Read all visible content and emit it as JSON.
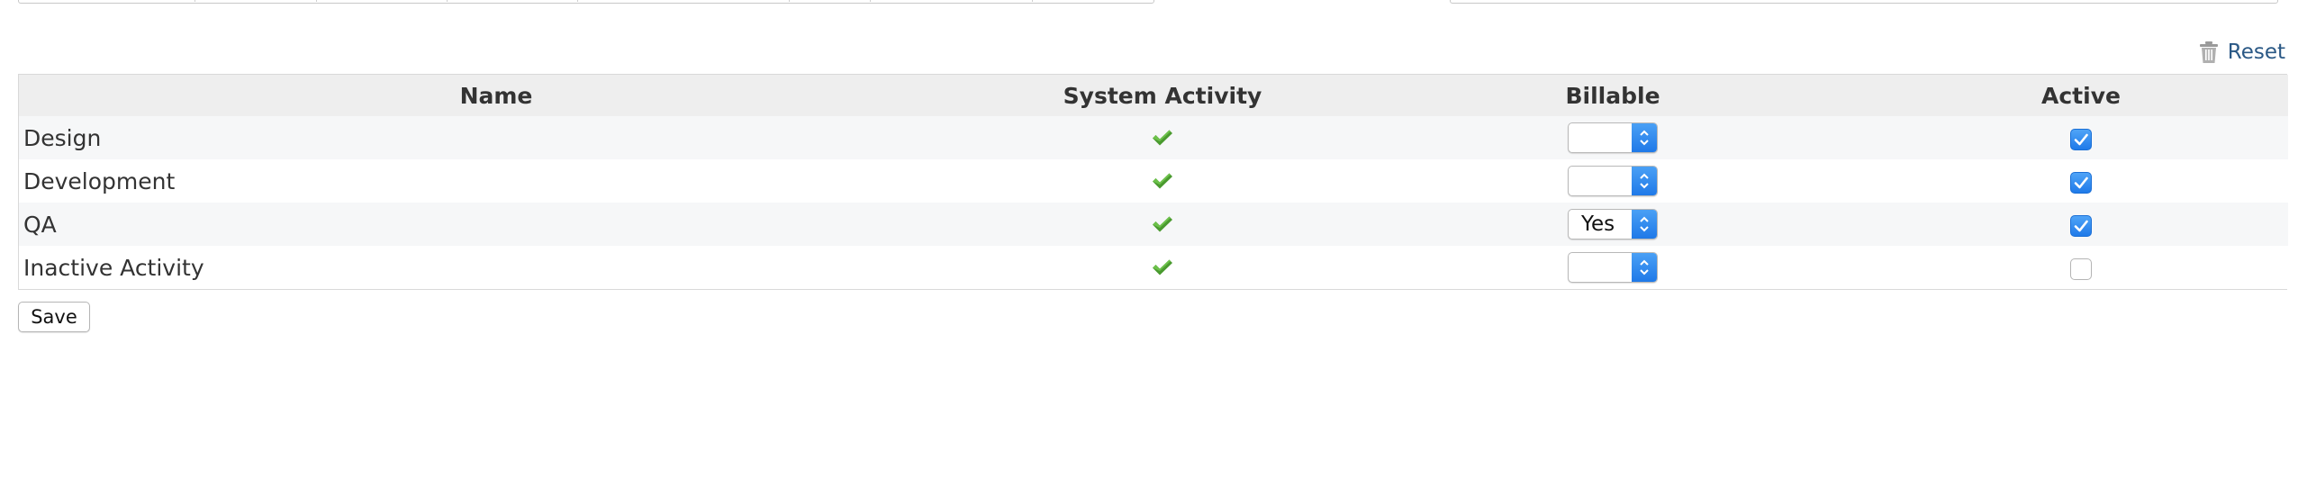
{
  "toolbar": {
    "reset_label": "Reset",
    "reset_icon": "trash-icon"
  },
  "table": {
    "columns": [
      "Name",
      "System Activity",
      "Billable",
      "Active"
    ],
    "rows": [
      {
        "name": "Design",
        "system_activity": true,
        "billable": "",
        "active": true
      },
      {
        "name": "Development",
        "system_activity": true,
        "billable": "",
        "active": true
      },
      {
        "name": "QA",
        "system_activity": true,
        "billable": "Yes",
        "active": true
      },
      {
        "name": "Inactive Activity",
        "system_activity": true,
        "billable": "",
        "active": false
      }
    ]
  },
  "actions": {
    "save_label": "Save"
  },
  "colors": {
    "link": "#2a5885",
    "check_green": "#4a9a2f",
    "accent_blue": "#1f7ae9",
    "header_bg": "#eeeeee"
  }
}
